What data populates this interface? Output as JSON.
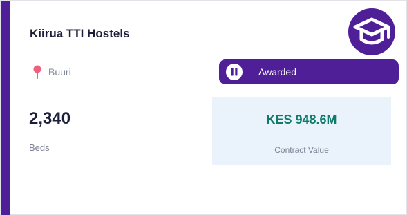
{
  "card": {
    "title": "Kiirua TTI Hostels",
    "logo_icon": "graduation-cap-icon",
    "location": {
      "icon": "map-pin-icon",
      "text": "Buuri"
    },
    "status": {
      "icon": "pause-icon",
      "label": "Awarded"
    },
    "stats": {
      "beds_value": "2,340",
      "beds_label": "Beds",
      "contract_value": "KES 948.6M",
      "contract_label": "Contract Value"
    }
  },
  "colors": {
    "brand_purple": "#4f1f97",
    "value_green": "#0f7a6a",
    "pin_pink": "#ef5f7f",
    "value_box_bg": "#eaf2fb"
  }
}
